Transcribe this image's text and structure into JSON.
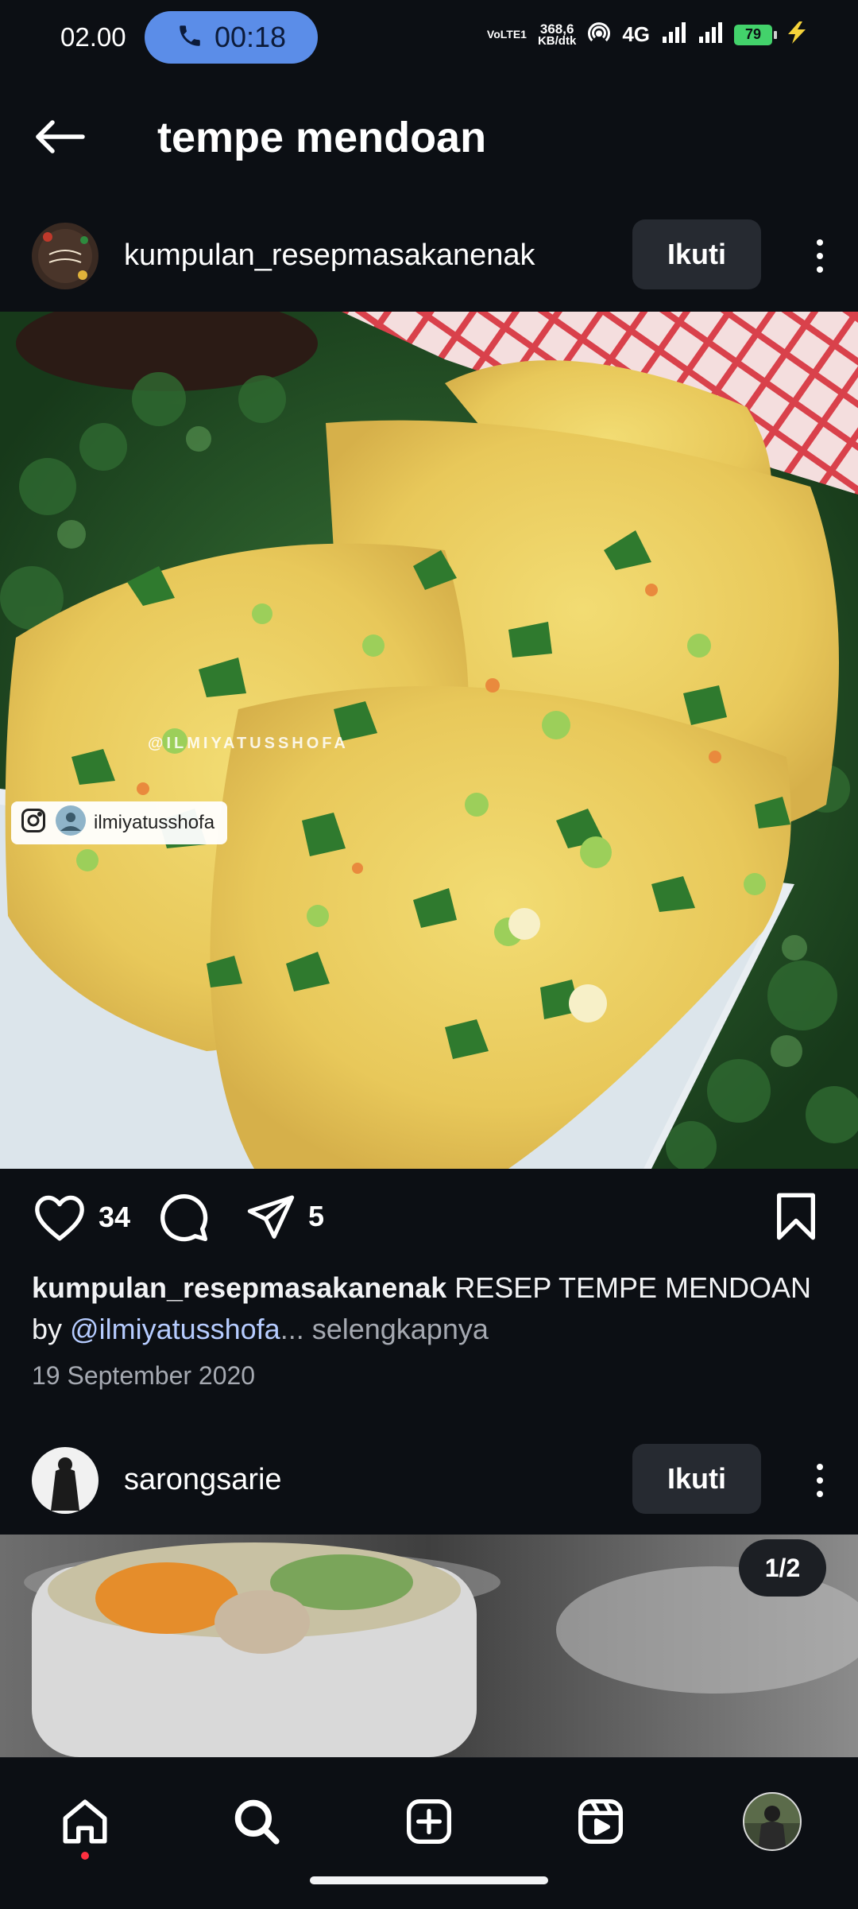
{
  "status_bar": {
    "time": "02.00",
    "call_duration": "00:18",
    "volte_label": "VoLTE1",
    "net_speed_value": "368,6",
    "net_speed_unit": "KB/dtk",
    "network_type": "4G",
    "battery_percent": "79"
  },
  "header": {
    "title": "tempe mendoan"
  },
  "post1": {
    "username": "kumpulan_resepmasakanenak",
    "follow_label": "Ikuti",
    "avatar_text": "Resep Masakan Enak",
    "image_watermark": "@ILMIYATUSSHOFA",
    "image_tag": "ilmiyatusshofa",
    "like_count": "34",
    "share_count": "5",
    "caption_user": "kumpulan_resepmasakanenak",
    "caption_text": "RESEP TEMPE MENDOAN",
    "caption_by": "by",
    "caption_mention": "@ilmiyatusshofa",
    "caption_more": "... selengkapnya",
    "date": "19 September 2020"
  },
  "post2": {
    "username": "sarongsarie",
    "follow_label": "Ikuti",
    "image_counter": "1/2"
  },
  "bottom_nav": {
    "items": [
      "home",
      "search",
      "create",
      "reels",
      "profile"
    ]
  },
  "colors": {
    "background": "#0c0f14",
    "call_pill": "#5b8de8",
    "follow_button": "#262a31",
    "mention": "#b6ccff",
    "notification_dot": "#ff3040"
  }
}
